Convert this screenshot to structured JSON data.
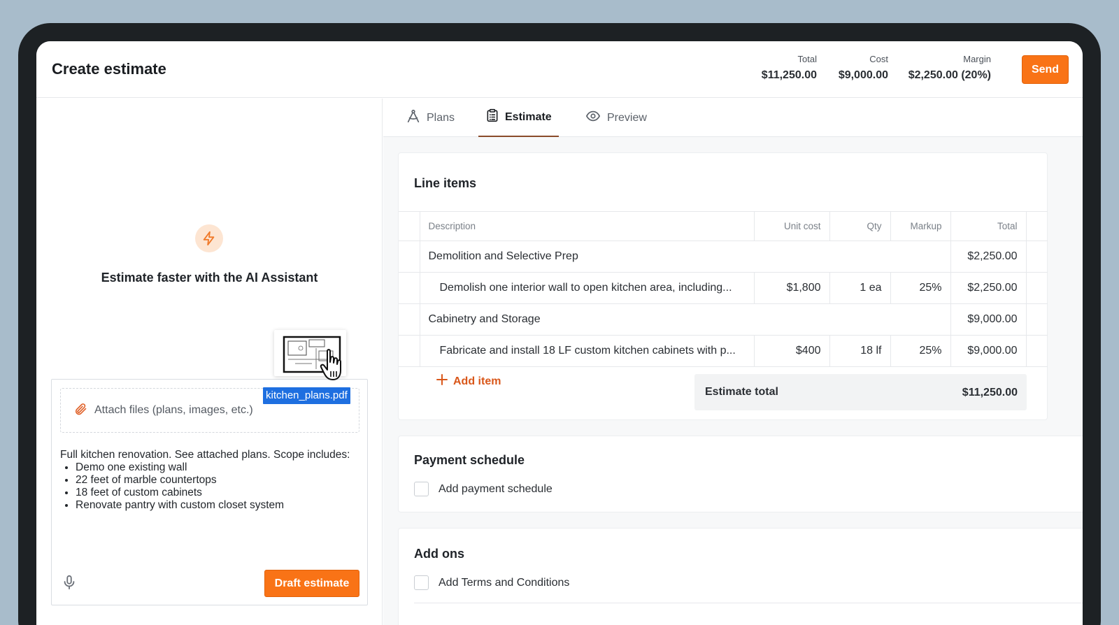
{
  "header": {
    "title": "Create estimate",
    "metrics": [
      {
        "label": "Total",
        "value": "$11,250.00"
      },
      {
        "label": "Cost",
        "value": "$9,000.00"
      },
      {
        "label": "Margin",
        "value": "$2,250.00 (20%)"
      }
    ],
    "send_label": "Send"
  },
  "assistant": {
    "heading": "Estimate faster with the AI Assistant",
    "attach_placeholder": "Attach files (plans, images, etc.)",
    "dragged_file": "kitchen_plans.pdf",
    "scope_intro": "Full kitchen renovation. See attached plans. Scope includes:",
    "scope_items": [
      "Demo one existing wall",
      "22 feet of marble countertops",
      "18 feet of custom cabinets",
      "Renovate pantry with custom closet system"
    ],
    "draft_label": "Draft estimate"
  },
  "tabs": [
    {
      "label": "Plans",
      "icon": "compass-icon",
      "active": false
    },
    {
      "label": "Estimate",
      "icon": "clipboard-icon",
      "active": true
    },
    {
      "label": "Preview",
      "icon": "eye-icon",
      "active": false
    }
  ],
  "line_items": {
    "title": "Line items",
    "columns": [
      "Description",
      "Unit cost",
      "Qty",
      "Markup",
      "Total"
    ],
    "rows": [
      {
        "type": "group",
        "description": "Demolition and Selective Prep",
        "total": "$2,250.00"
      },
      {
        "type": "item",
        "description": "Demolish one interior wall to open kitchen area, including...",
        "unit_cost": "$1,800",
        "qty": "1 ea",
        "markup": "25%",
        "total": "$2,250.00"
      },
      {
        "type": "group",
        "description": "Cabinetry and Storage",
        "total": "$9,000.00"
      },
      {
        "type": "item",
        "description": "Fabricate and install 18 LF custom kitchen cabinets with p...",
        "unit_cost": "$400",
        "qty": "18 lf",
        "markup": "25%",
        "total": "$9,000.00"
      }
    ],
    "add_item_label": "Add item",
    "estimate_total_label": "Estimate total",
    "estimate_total_value": "$11,250.00"
  },
  "payment_schedule": {
    "title": "Payment schedule",
    "checkbox_label": "Add payment schedule"
  },
  "add_ons": {
    "title": "Add ons",
    "checkbox_label": "Add Terms and Conditions"
  },
  "colors": {
    "accent": "#f97316",
    "link": "#d9571a",
    "background": "#a8bccb",
    "file_tag": "#1e6fe0"
  }
}
